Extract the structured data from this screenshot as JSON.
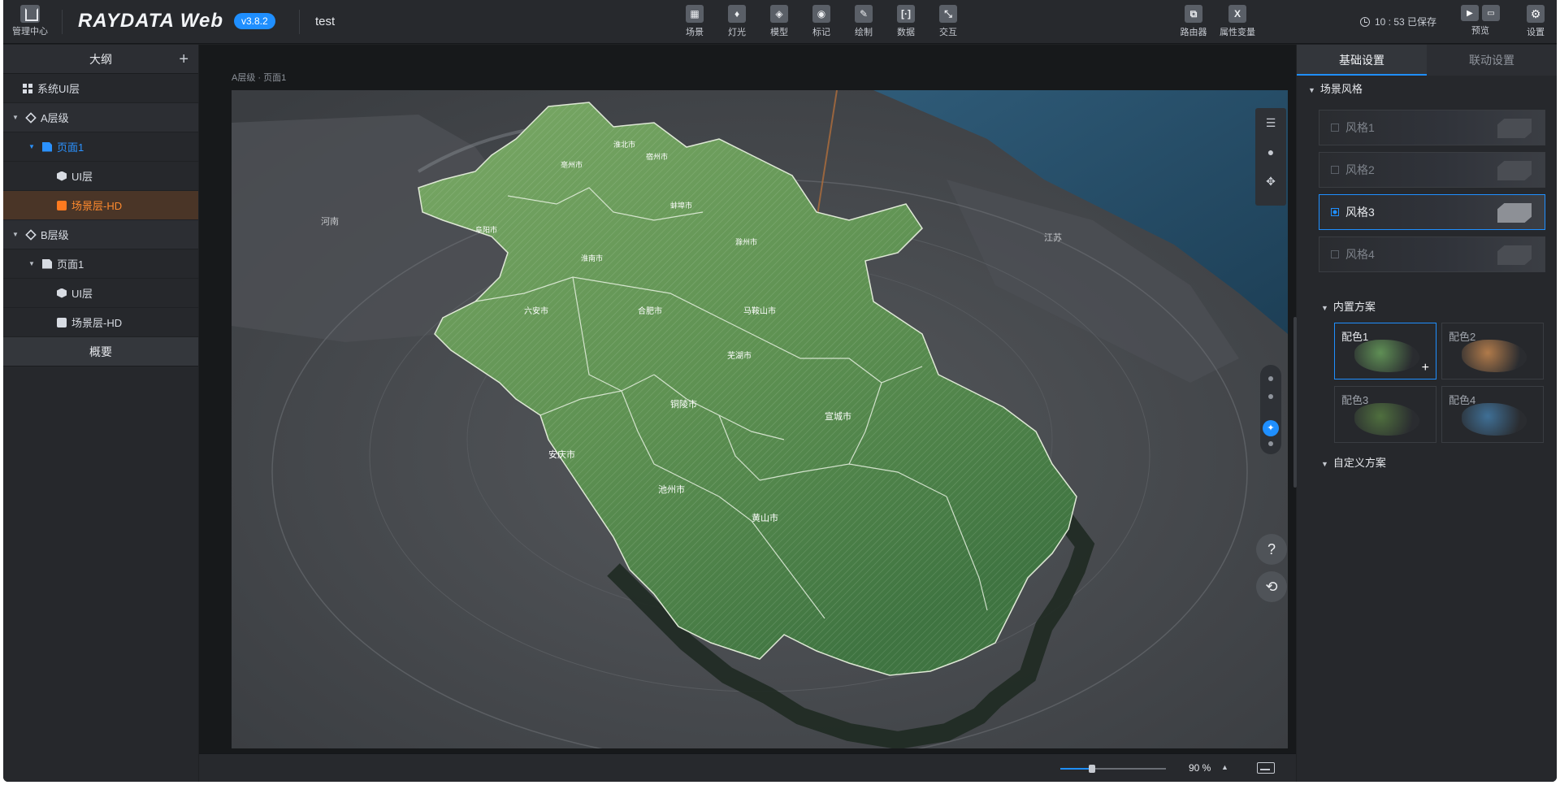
{
  "topbar": {
    "home_label": "管理中心",
    "logo": "RAYDATA Web",
    "version": "v3.8.2",
    "doc_title": "test",
    "tools": [
      {
        "label": "场景",
        "icon": "scene-icon",
        "glyph": "▦"
      },
      {
        "label": "灯光",
        "icon": "light-icon",
        "glyph": "♦"
      },
      {
        "label": "模型",
        "icon": "model-icon",
        "glyph": "◈"
      },
      {
        "label": "标记",
        "icon": "marker-icon",
        "glyph": "◉"
      },
      {
        "label": "绘制",
        "icon": "draw-icon",
        "glyph": "✎"
      },
      {
        "label": "数据",
        "icon": "data-icon",
        "glyph": "[·]"
      },
      {
        "label": "交互",
        "icon": "interact-icon",
        "glyph": "⤡"
      }
    ],
    "tools_right": [
      {
        "label": "路由器",
        "icon": "router-icon",
        "glyph": "⧉"
      },
      {
        "label": "属性变量",
        "icon": "variable-icon",
        "glyph": "X"
      }
    ],
    "save_status": "10 : 53 已保存",
    "preview_label": "预览",
    "settings_label": "设置"
  },
  "outline": {
    "title": "大纲",
    "items": [
      {
        "label": "系统UI层"
      },
      {
        "label": "A层级"
      },
      {
        "label": "页面1"
      },
      {
        "label": "UI层"
      },
      {
        "label": "场景层-HD"
      },
      {
        "label": "B层级"
      },
      {
        "label": "页面1"
      },
      {
        "label": "UI层"
      },
      {
        "label": "场景层-HD"
      }
    ],
    "summary": "概要"
  },
  "canvas": {
    "breadcrumb": "A层级 · 页面1",
    "map_labels": {
      "province_left": "河南",
      "province_right": "江苏",
      "cities": [
        {
          "name": "亳州市"
        },
        {
          "name": "宿州市"
        },
        {
          "name": "淮北市"
        },
        {
          "name": "阜阳市"
        },
        {
          "name": "蚌埠市"
        },
        {
          "name": "淮南市"
        },
        {
          "name": "滁州市"
        },
        {
          "name": "六安市"
        },
        {
          "name": "合肥市"
        },
        {
          "name": "马鞍山市"
        },
        {
          "name": "芜湖市"
        },
        {
          "name": "铜陵市"
        },
        {
          "name": "宣城市"
        },
        {
          "name": "安庆市"
        },
        {
          "name": "池州市"
        },
        {
          "name": "黄山市"
        }
      ]
    },
    "zoom": 0.9,
    "zoom_label": "90 %"
  },
  "right_panel": {
    "tabs": [
      {
        "label": "基础设置",
        "active": true
      },
      {
        "label": "联动设置",
        "active": false
      }
    ],
    "scene_style": {
      "title": "场景风格",
      "options": [
        {
          "label": "风格1",
          "active": false
        },
        {
          "label": "风格2",
          "active": false
        },
        {
          "label": "风格3",
          "active": true
        },
        {
          "label": "风格4",
          "active": false
        }
      ]
    },
    "builtin": {
      "title": "内置方案",
      "palettes": [
        {
          "label": "配色1",
          "active": true,
          "color": "#5f8f55"
        },
        {
          "label": "配色2",
          "active": false,
          "color": "#b07a4a"
        },
        {
          "label": "配色3",
          "active": false,
          "color": "#4f6f3e"
        },
        {
          "label": "配色4",
          "active": false,
          "color": "#3f6f95"
        }
      ]
    },
    "custom_title": "自定义方案"
  },
  "colors": {
    "accent": "#1f8fff",
    "selected_orange": "#ff8a2e",
    "map_green": "#5e9152",
    "water": "#244c66"
  }
}
